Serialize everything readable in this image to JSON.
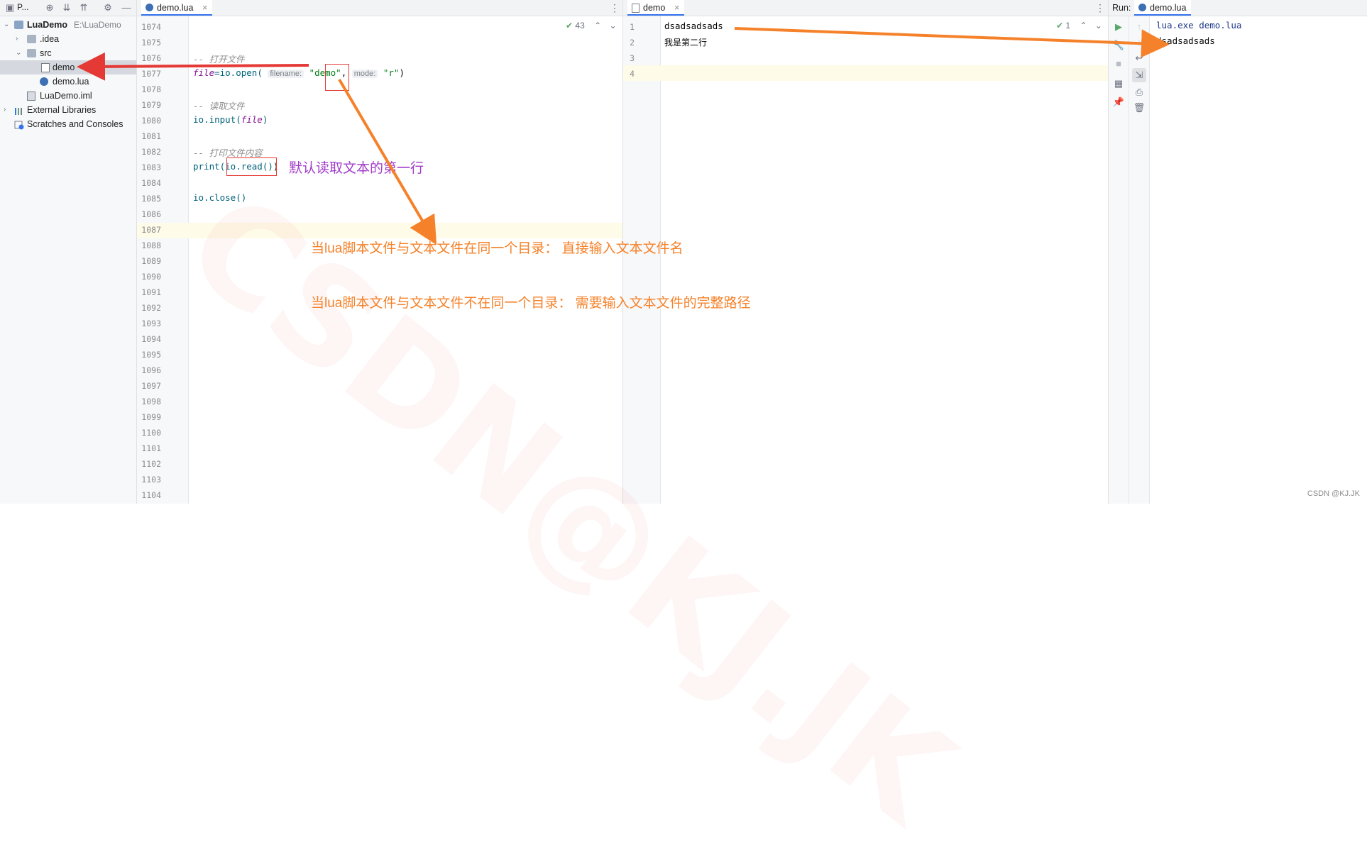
{
  "project": {
    "toolbar_title": "P...",
    "tree": [
      {
        "label": "LuaDemo",
        "path": "E:\\LuaDemo"
      },
      {
        "label": ".idea"
      },
      {
        "label": "src"
      },
      {
        "label": "demo"
      },
      {
        "label": "demo.lua"
      },
      {
        "label": "LuaDemo.iml"
      },
      {
        "label": "External Libraries"
      },
      {
        "label": "Scratches and Consoles"
      }
    ]
  },
  "editor1": {
    "tab_label": "demo.lua",
    "inspection_count": "43",
    "line_numbers": [
      "1074",
      "1075",
      "1076",
      "1077",
      "1078",
      "1079",
      "1080",
      "1081",
      "1082",
      "1083",
      "1084",
      "1085",
      "1086",
      "1087",
      "1088",
      "1089",
      "1090",
      "1091",
      "1092",
      "1093",
      "1094",
      "1095",
      "1096",
      "1097",
      "1098",
      "1099",
      "1100",
      "1101",
      "1102",
      "1103",
      "1104"
    ],
    "code": {
      "comment_open": "-- 打开文件",
      "l1077_var": "file",
      "l1077_eq": "=io.open(",
      "hint_filename": "filename:",
      "l1077_str1": "\"demo\"",
      "l1077_comma": ",",
      "hint_mode": "mode:",
      "l1077_str2": "\"r\"",
      "l1077_end": ")",
      "comment_read": "-- 读取文件",
      "l1080_a": "io.input(",
      "l1080_var": "file",
      "l1080_b": ")",
      "comment_print": "-- 打印文件内容",
      "l1083_a": "print(",
      "l1083_b": "io.read()",
      "l1083_c": ")",
      "l1085": "io.close()"
    }
  },
  "editor2": {
    "tab_label": "demo",
    "inspection_count": "1",
    "line_numbers": [
      "1",
      "2",
      "3",
      "4"
    ],
    "lines": [
      "dsadsadsads",
      "我是第二行",
      "",
      ""
    ]
  },
  "run": {
    "label": "Run:",
    "tab_label": "demo.lua",
    "output": [
      "lua.exe demo.lua",
      "dsadsadsads"
    ]
  },
  "annotations": {
    "read_note": "默认读取文本的第一行",
    "same_dir": "当lua脚本文件与文本文件在同一个目录：  直接输入文本文件名",
    "diff_dir": "当lua脚本文件与文本文件不在同一个目录：  需要输入文本文件的完整路径",
    "watermark": "CSDN@KJ.JK",
    "corner_watermark": "CSDN @KJ.JK"
  },
  "colors": {
    "accent": "#3574f0",
    "annotation_orange": "#f5822a",
    "annotation_purple": "#a23cc8",
    "arrow_red": "#e53935"
  }
}
